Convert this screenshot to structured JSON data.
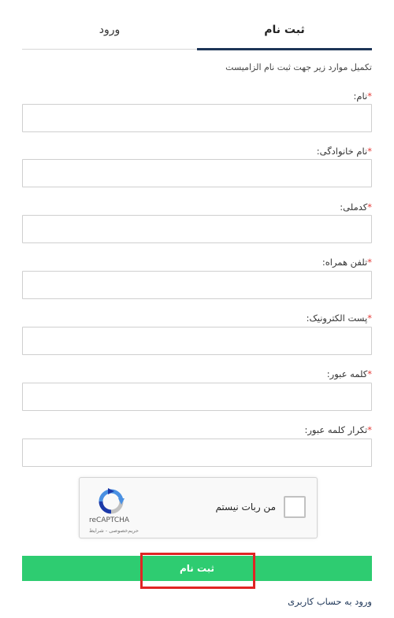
{
  "tabs": {
    "register": "ثبت نام",
    "login": "ورود"
  },
  "intro": "تکمیل موارد زیر جهت ثبت نام الزامیست",
  "required_mark": "*",
  "fields": [
    {
      "label": "نام:"
    },
    {
      "label": "نام خانوادگی:"
    },
    {
      "label": "کدملی:"
    },
    {
      "label": "تلفن همراه:"
    },
    {
      "label": "پست الکترونیک:"
    },
    {
      "label": "کلمه عبور:"
    },
    {
      "label": "تکرار کلمه عبور:"
    }
  ],
  "captcha": {
    "label": "من ربات نیستم",
    "brand": "reCAPTCHA",
    "terms": "حریم‌خصوصی - شرایط"
  },
  "submit_label": "ثبت نام",
  "login_link": "ورود به حساب کاربری",
  "colors": {
    "accent": "#1d3557",
    "submit": "#2ecc71",
    "required": "#e53935",
    "highlight": "#e02424"
  }
}
